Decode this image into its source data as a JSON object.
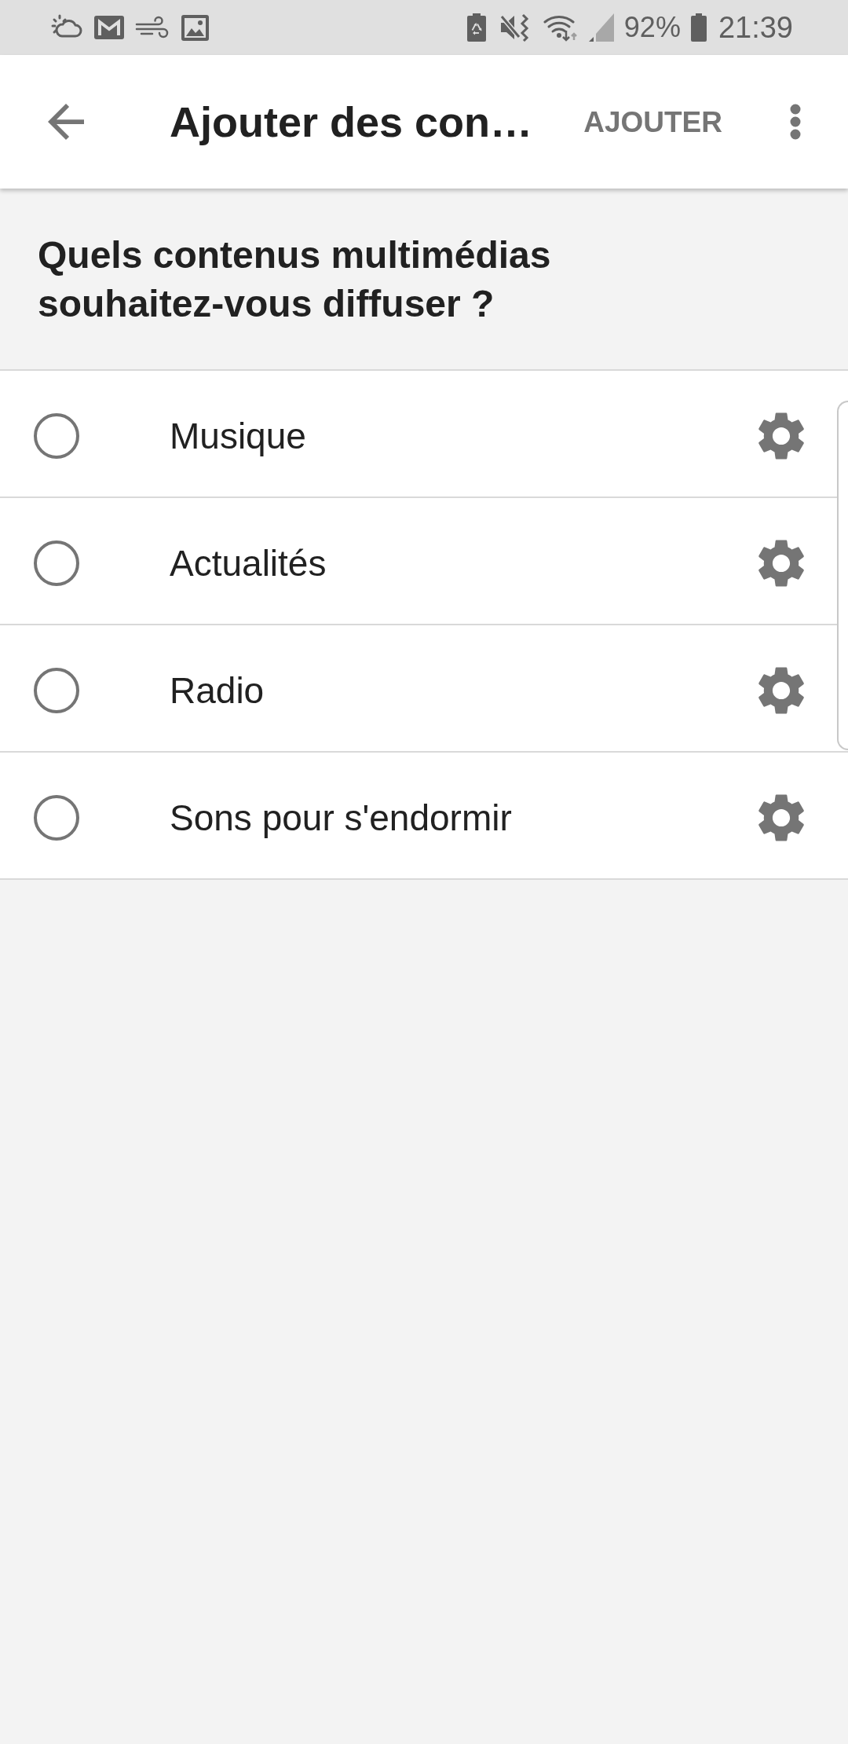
{
  "status_bar": {
    "battery": "92%",
    "time": "21:39"
  },
  "app_bar": {
    "title": "Ajouter des con…",
    "action": "AJOUTER"
  },
  "prompt": "Quels contenus multimédias souhaitez-vous diffuser ?",
  "options": [
    {
      "label": "Musique",
      "selected": false
    },
    {
      "label": "Actualités",
      "selected": false
    },
    {
      "label": "Radio",
      "selected": false
    },
    {
      "label": "Sons pour s'endormir",
      "selected": false
    }
  ]
}
